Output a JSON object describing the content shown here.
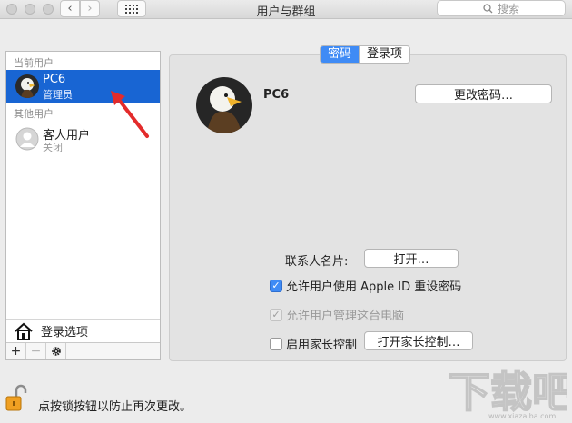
{
  "window": {
    "title": "用户与群组"
  },
  "search": {
    "placeholder": "搜索"
  },
  "sidebar": {
    "current_label": "当前用户",
    "other_label": "其他用户",
    "users": [
      {
        "name": "PC6",
        "role": "管理员"
      },
      {
        "name": "客人用户",
        "role": "关闭"
      }
    ],
    "login_options": "登录选项"
  },
  "tabs": {
    "password": "密码",
    "login_items": "登录项"
  },
  "user": {
    "name": "PC6"
  },
  "buttons": {
    "change_password": "更改密码…",
    "open": "打开…",
    "parental_open": "打开家长控制…"
  },
  "contact_card_label": "联系人名片:",
  "checks": {
    "allow_apple_id": "允许用户使用 Apple ID 重设密码",
    "allow_admin": "允许用户管理这台电脑",
    "enable_parental": "启用家长控制"
  },
  "lock_text": "点按锁按钮以防止再次更改。",
  "watermark": {
    "text": "下载吧",
    "url": "www.xiazaiba.com"
  },
  "colors": {
    "selection": "#1865d3",
    "accent": "#3f8bf5",
    "arrow": "#e32b2b"
  }
}
